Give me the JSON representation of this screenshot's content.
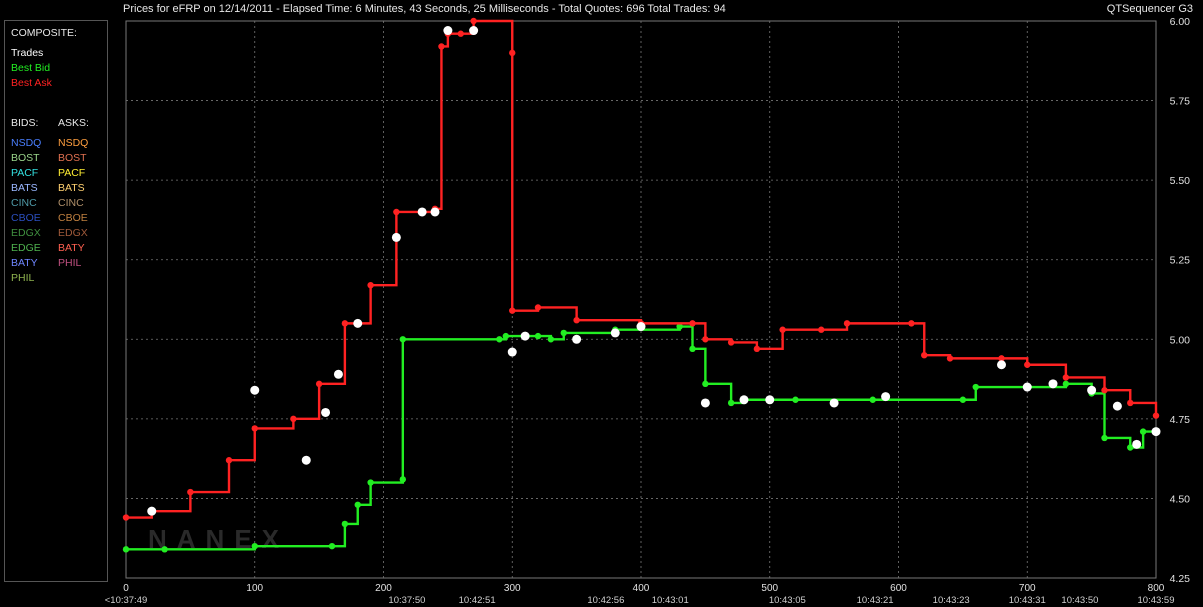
{
  "header": {
    "title": "Prices for  eFRP  on  12/14/2011  -  Elapsed Time: 6 Minutes, 43 Seconds, 25 Milliseconds  -  Total Quotes: 696  Total Trades: 94",
    "app_name": "QTSequencer G3"
  },
  "legend": {
    "composite_heading": "COMPOSITE:",
    "composite_items": [
      {
        "label": "Trades",
        "color": "#ffffff"
      },
      {
        "label": "Best Bid",
        "color": "#22ee22"
      },
      {
        "label": "Best Ask",
        "color": "#ff2222"
      }
    ],
    "bids_heading": "BIDS:",
    "asks_heading": "ASKS:",
    "bids": [
      {
        "label": "NSDQ",
        "color": "#4a7fff"
      },
      {
        "label": "BOST",
        "color": "#9ad48a"
      },
      {
        "label": "PACF",
        "color": "#33e0e0"
      },
      {
        "label": "BATS",
        "color": "#9ab7ff"
      },
      {
        "label": "CINC",
        "color": "#4f9aa8"
      },
      {
        "label": "CBOE",
        "color": "#2b4fbf"
      },
      {
        "label": "EDGX",
        "color": "#3f8f3f"
      },
      {
        "label": "EDGE",
        "color": "#4fb34f"
      },
      {
        "label": "BATY",
        "color": "#6f86ff"
      },
      {
        "label": "PHIL",
        "color": "#8fb34f"
      }
    ],
    "asks": [
      {
        "label": "NSDQ",
        "color": "#ff9f3f"
      },
      {
        "label": "BOST",
        "color": "#e07050"
      },
      {
        "label": "PACF",
        "color": "#ffee33"
      },
      {
        "label": "BATS",
        "color": "#ffd070"
      },
      {
        "label": "CINC",
        "color": "#b0906a"
      },
      {
        "label": "CBOE",
        "color": "#c08040"
      },
      {
        "label": "EDGX",
        "color": "#a05a3a"
      },
      {
        "label": "BATY",
        "color": "#ff6050"
      },
      {
        "label": "PHIL",
        "color": "#c05080"
      }
    ]
  },
  "watermark": "NANEX",
  "chart_data": {
    "type": "line",
    "title": "",
    "xlabel": "",
    "ylabel": "",
    "xlim": [
      0,
      800
    ],
    "ylim": [
      4.25,
      6.0
    ],
    "y_ticks": [
      "6.00",
      "5.75",
      "5.50",
      "5.25",
      "5.00",
      "4.75",
      "4.50",
      "4.25"
    ],
    "x_ticks": [
      {
        "value": 0,
        "label": "0",
        "time": "<10:37:49"
      },
      {
        "value": 100,
        "label": "100",
        "time": ""
      },
      {
        "value": 200,
        "label": "200",
        "time": "10:37:50"
      },
      {
        "value": 300,
        "label": "300",
        "time": "10:42:51"
      },
      {
        "value": 400,
        "label": "400",
        "time": "10:42:56"
      },
      {
        "value": 500,
        "label": "500",
        "time": "10:43:01"
      },
      {
        "value": 600,
        "label": "600",
        "time": "10:43:05"
      },
      {
        "value": 700,
        "label": "700",
        "time": "10:43:21"
      },
      {
        "value": 800,
        "label": "800",
        "time": "10:43:23"
      }
    ],
    "time_labels": [
      {
        "x": 0,
        "label": "<10:37:49"
      },
      {
        "x": 240,
        "label": "10:37:50"
      },
      {
        "x": 300,
        "label": "10:42:51"
      },
      {
        "x": 410,
        "label": "10:42:56"
      },
      {
        "x": 465,
        "label": "10:43:01"
      },
      {
        "x": 565,
        "label": "10:43:05"
      },
      {
        "x": 640,
        "label": "10:43:21"
      },
      {
        "x": 705,
        "label": "10:43:23"
      },
      {
        "x": 770,
        "label": "10:43:31"
      },
      {
        "x": 815,
        "label": "10:43:50"
      },
      {
        "x": 880,
        "label": "10:43:59"
      }
    ],
    "grid": true,
    "series": [
      {
        "name": "Best Bid",
        "color": "#22ee22",
        "points": [
          [
            0,
            4.34
          ],
          [
            30,
            4.34
          ],
          [
            100,
            4.35
          ],
          [
            160,
            4.35
          ],
          [
            170,
            4.42
          ],
          [
            180,
            4.48
          ],
          [
            190,
            4.55
          ],
          [
            215,
            4.56
          ],
          [
            215,
            5.0
          ],
          [
            290,
            5.0
          ],
          [
            295,
            5.01
          ],
          [
            320,
            5.01
          ],
          [
            330,
            5.0
          ],
          [
            340,
            5.02
          ],
          [
            380,
            5.03
          ],
          [
            430,
            5.04
          ],
          [
            440,
            4.97
          ],
          [
            450,
            4.86
          ],
          [
            470,
            4.8
          ],
          [
            480,
            4.81
          ],
          [
            520,
            4.81
          ],
          [
            580,
            4.81
          ],
          [
            650,
            4.81
          ],
          [
            660,
            4.85
          ],
          [
            700,
            4.85
          ],
          [
            730,
            4.86
          ],
          [
            750,
            4.83
          ],
          [
            760,
            4.69
          ],
          [
            780,
            4.66
          ],
          [
            790,
            4.71
          ],
          [
            800,
            4.71
          ]
        ]
      },
      {
        "name": "Best Ask",
        "color": "#ff2222",
        "points": [
          [
            0,
            4.44
          ],
          [
            20,
            4.46
          ],
          [
            50,
            4.52
          ],
          [
            80,
            4.62
          ],
          [
            100,
            4.72
          ],
          [
            130,
            4.75
          ],
          [
            150,
            4.86
          ],
          [
            170,
            5.05
          ],
          [
            190,
            5.17
          ],
          [
            210,
            5.4
          ],
          [
            240,
            5.41
          ],
          [
            245,
            5.92
          ],
          [
            250,
            5.96
          ],
          [
            260,
            5.96
          ],
          [
            270,
            6.0
          ],
          [
            300,
            5.9
          ],
          [
            300,
            5.09
          ],
          [
            320,
            5.1
          ],
          [
            350,
            5.06
          ],
          [
            400,
            5.05
          ],
          [
            440,
            5.05
          ],
          [
            450,
            5.0
          ],
          [
            470,
            4.99
          ],
          [
            490,
            4.97
          ],
          [
            510,
            5.03
          ],
          [
            540,
            5.03
          ],
          [
            560,
            5.05
          ],
          [
            610,
            5.05
          ],
          [
            620,
            4.95
          ],
          [
            640,
            4.94
          ],
          [
            680,
            4.94
          ],
          [
            700,
            4.92
          ],
          [
            730,
            4.88
          ],
          [
            760,
            4.84
          ],
          [
            780,
            4.8
          ],
          [
            800,
            4.76
          ]
        ]
      },
      {
        "name": "Trades",
        "color": "#ffffff",
        "points": [
          [
            20,
            4.46
          ],
          [
            100,
            4.84
          ],
          [
            140,
            4.62
          ],
          [
            155,
            4.77
          ],
          [
            165,
            4.89
          ],
          [
            180,
            5.05
          ],
          [
            210,
            5.32
          ],
          [
            230,
            5.4
          ],
          [
            240,
            5.4
          ],
          [
            250,
            5.97
          ],
          [
            270,
            5.97
          ],
          [
            300,
            4.96
          ],
          [
            310,
            5.01
          ],
          [
            350,
            5.0
          ],
          [
            380,
            5.02
          ],
          [
            400,
            5.04
          ],
          [
            450,
            4.8
          ],
          [
            480,
            4.81
          ],
          [
            500,
            4.81
          ],
          [
            550,
            4.8
          ],
          [
            590,
            4.82
          ],
          [
            680,
            4.92
          ],
          [
            700,
            4.85
          ],
          [
            720,
            4.86
          ],
          [
            750,
            4.84
          ],
          [
            770,
            4.79
          ],
          [
            785,
            4.67
          ],
          [
            800,
            4.71
          ]
        ]
      }
    ]
  }
}
